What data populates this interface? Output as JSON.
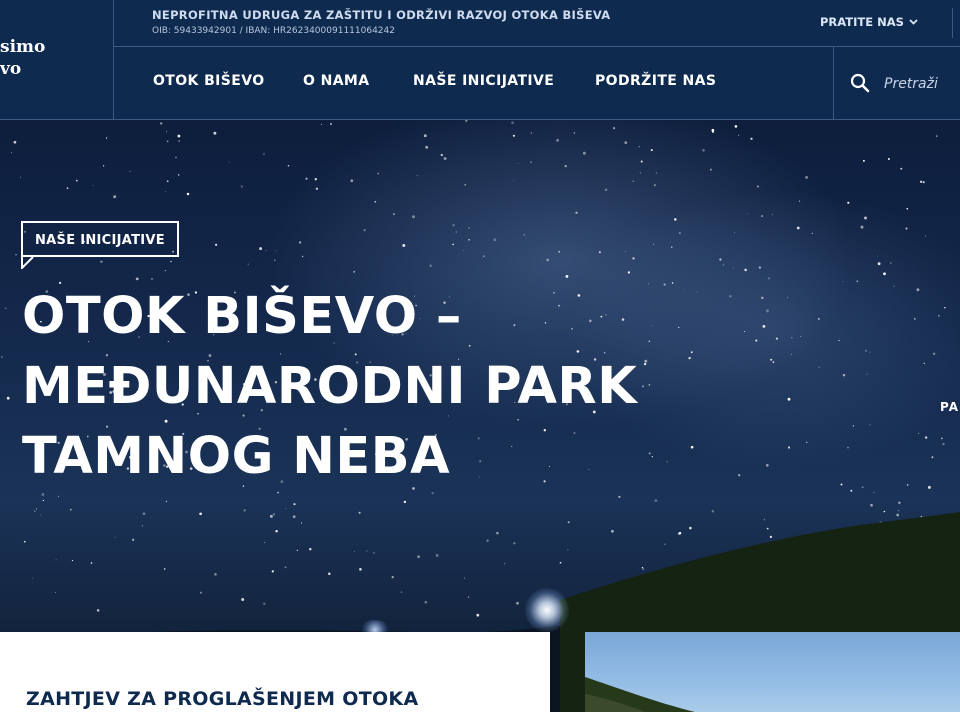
{
  "header": {
    "logo_text": "simo\nvo",
    "org_name": "NEPROFITNA UDRUGA ZA ZAŠTITU I ODRŽIVI RAZVOJ OTOKA BIŠEVA",
    "org_ids": "OIB: 59433942901 / IBAN: HR2623400091111064242",
    "follow_label": "PRATITE NAS",
    "nav": [
      "OTOK BIŠEVO",
      "O NAMA",
      "NAŠE INICIJATIVE",
      "PODRŽITE NAS"
    ],
    "search": {
      "placeholder": "Pretraži"
    }
  },
  "hero": {
    "tag": "NAŠE INICIJATIVE",
    "title": "OTOK BIŠEVO – MEĐUNARODNI PARK TAMNOG NEBA",
    "side_text": "PA"
  },
  "cards": {
    "first_title": "ZAHTJEV ZA PROGLAŠENJEM OTOKA"
  },
  "colors": {
    "header_bg": "#0f2a4f",
    "border": "#3d5a82",
    "text": "#ffffff"
  }
}
